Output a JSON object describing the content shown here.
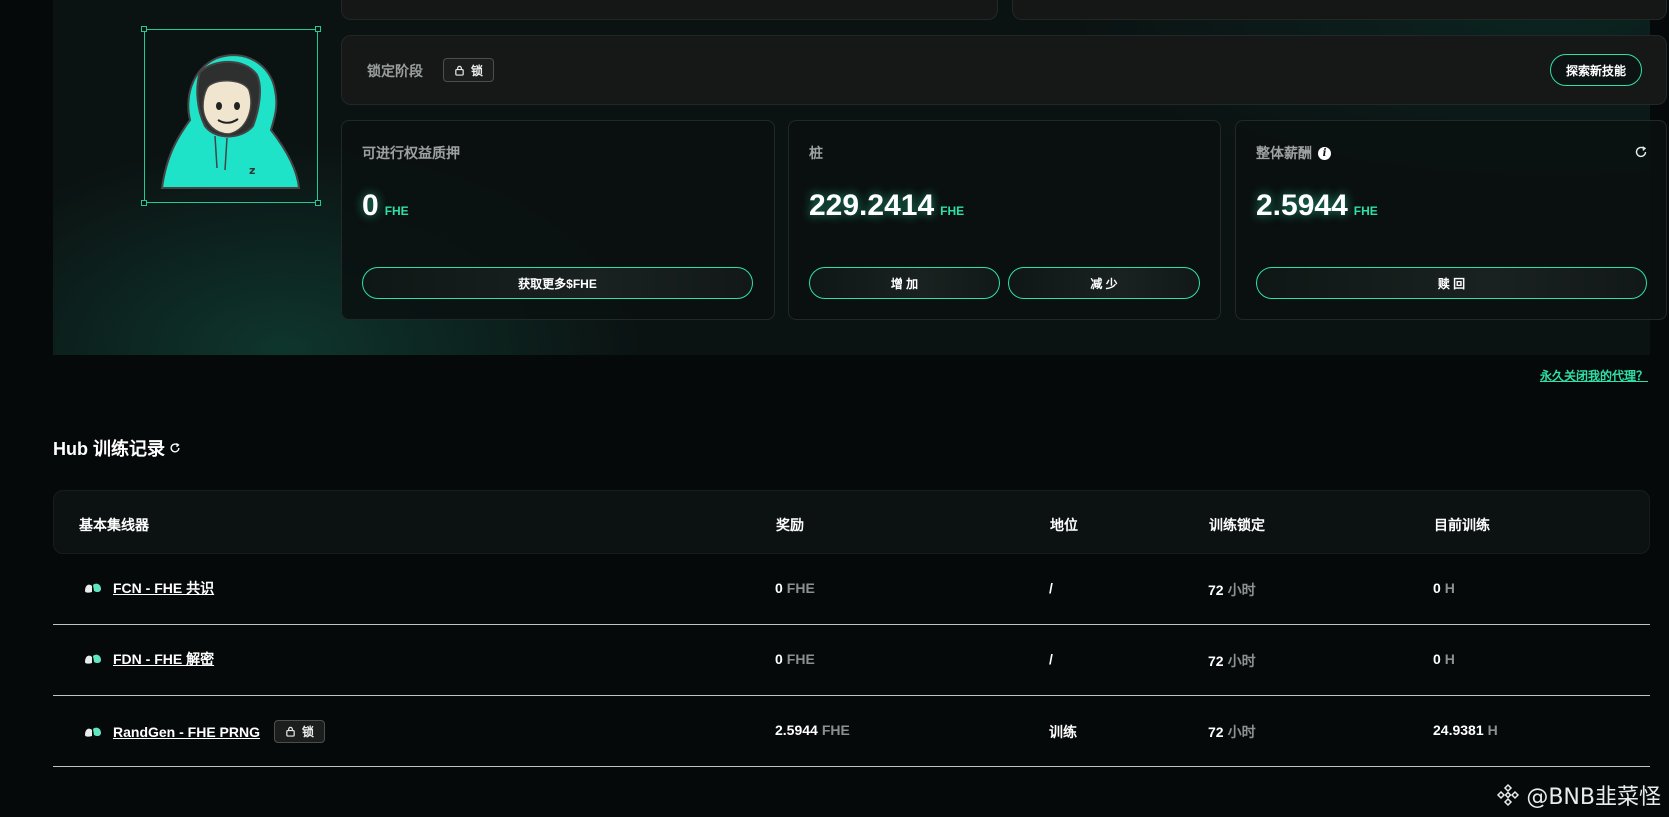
{
  "phase": {
    "label": "锁定阶段",
    "lock_badge": "锁",
    "explore_button": "探索新技能"
  },
  "cards": {
    "stakeable": {
      "title": "可进行权益质押",
      "value": "0",
      "unit": "FHE",
      "button": "获取更多$FHE"
    },
    "stake": {
      "title": "桩",
      "value": "229.2414",
      "unit": "FHE",
      "increase": "增 加",
      "decrease": "减 少"
    },
    "rewards": {
      "title": "整体薪酬",
      "value": "2.5944",
      "unit": "FHE",
      "button": "赎 回"
    }
  },
  "close_agent_link": "永久关闭我的代理？",
  "hub": {
    "title": "Hub 训练记录",
    "columns": [
      "基本集线器",
      "奖励",
      "地位",
      "训练锁定",
      "目前训练"
    ],
    "rows": [
      {
        "name": "FCN - FHE 共识",
        "locked": false,
        "reward": "0",
        "reward_unit": "FHE",
        "status": "/",
        "lock_value": "72",
        "lock_unit": "小时",
        "current": "0",
        "current_unit": "H"
      },
      {
        "name": "FDN - FHE 解密",
        "locked": false,
        "reward": "0",
        "reward_unit": "FHE",
        "status": "/",
        "lock_value": "72",
        "lock_unit": "小时",
        "current": "0",
        "current_unit": "H"
      },
      {
        "name": "RandGen - FHE PRNG",
        "locked": true,
        "lock_badge": "锁",
        "reward": "2.5944",
        "reward_unit": "FHE",
        "status": "训练",
        "lock_value": "72",
        "lock_unit": "小时",
        "current": "24.9381",
        "current_unit": "H"
      }
    ]
  },
  "watermark": "@BNB韭菜怪",
  "colors": {
    "accent": "#2fe0a5",
    "background": "#060909",
    "panel": "#0b1212"
  }
}
